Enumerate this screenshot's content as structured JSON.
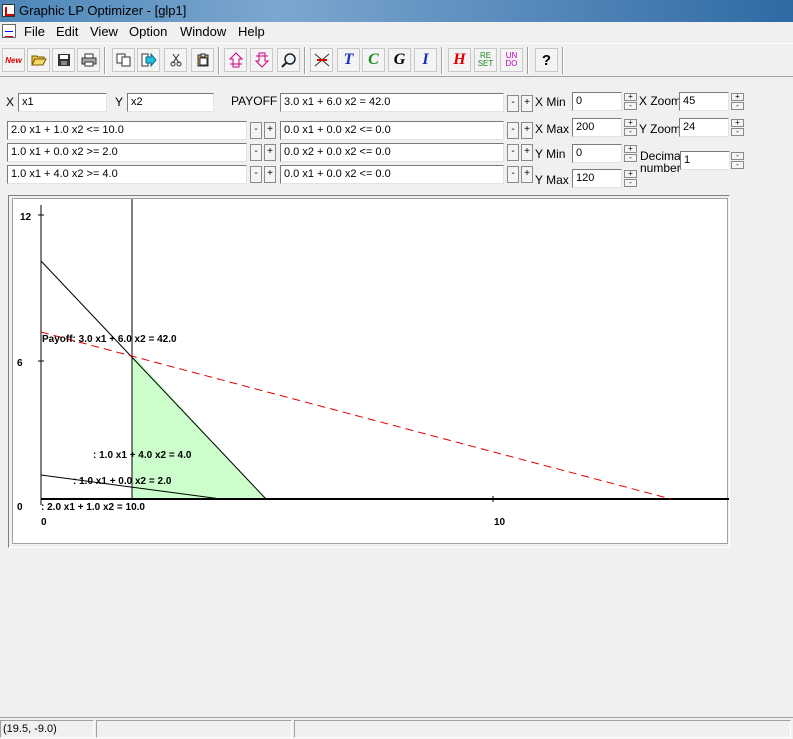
{
  "window": {
    "title": "Graphic LP Optimizer - [glp1]"
  },
  "menu": [
    "File",
    "Edit",
    "View",
    "Option",
    "Window",
    "Help"
  ],
  "toolbar": {
    "new": "New",
    "text": "T",
    "constraint": "C",
    "graph": "G",
    "integer": "I",
    "help": "H",
    "reset_top": "RE",
    "reset_bottom": "SET",
    "undo_top": "UN",
    "undo_bottom": "DO",
    "about": "?"
  },
  "vars": {
    "x_label": "X",
    "x_value": "x1",
    "y_label": "Y",
    "y_value": "x2"
  },
  "payoff": {
    "label": "PAYOFF",
    "value": "3.0 x1 +  6.0 x2 = 42.0"
  },
  "constraints_left": [
    "2.0 x1 +  1.0 x2 <=  10.0",
    "1.0 x1 +  0.0 x2 >=  2.0",
    "1.0 x1 +  4.0 x2 >=  4.0"
  ],
  "constraints_right": [
    "0.0 x1 +  0.0 x2 <=  0.0",
    "0.0 x2 +  0.0 x2 <=  0.0",
    "0.0 x1 +  0.0 x2 <=  0.0"
  ],
  "pm": {
    "minus": "-",
    "plus": "+"
  },
  "axes_controls": {
    "x_min_label": "X Min",
    "x_min": "0",
    "x_max_label": "X Max",
    "x_max": "200",
    "y_min_label": "Y Min",
    "y_min": "0",
    "y_max_label": "Y Max",
    "y_max": "120",
    "x_zoom_label": "X Zoom",
    "x_zoom": "45",
    "y_zoom_label": "Y Zoom",
    "y_zoom": "24",
    "decimal_label_1": "Decimal",
    "decimal_label_2": "number",
    "decimal": "1"
  },
  "graph": {
    "y_ticks": [
      "12",
      "6",
      "0"
    ],
    "x_ticks": [
      "0",
      "10"
    ],
    "payoff_label": "Payoff:  3.0 x1 +  6.0 x2 =  42.0",
    "c3_label": ":  1.0 x1 +  4.0 x2 =  4.0",
    "c2_label": ":  1.0 x1 +  0.0 x2 =  2.0",
    "c1_label": ":  2.0 x1 +  1.0 x2 =  10.0",
    "colors": {
      "feasible": "#ccffcc",
      "payoff_line": "#e00000",
      "constraint": "#000000"
    }
  },
  "status": {
    "coords": "(19.5, -9.0)"
  }
}
